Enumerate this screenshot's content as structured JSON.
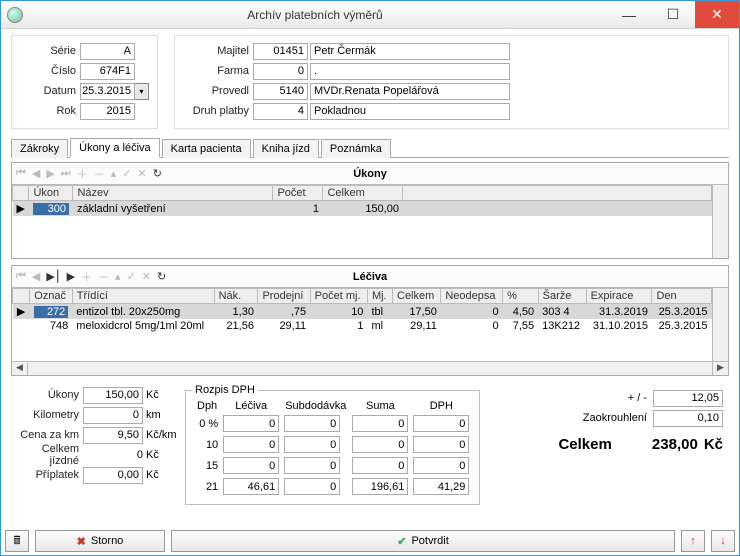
{
  "window": {
    "title": "Archív platebních výměrů"
  },
  "left": {
    "serie": {
      "label": "Série",
      "value": "A"
    },
    "cislo": {
      "label": "Číslo",
      "value": "674F1"
    },
    "datum": {
      "label": "Datum",
      "value": "25.3.2015"
    },
    "rok": {
      "label": "Rok",
      "value": "2015"
    }
  },
  "right": {
    "majitel": {
      "label": "Majitel",
      "code": "01451",
      "text": "Petr Čermák"
    },
    "farma": {
      "label": "Farma",
      "code": "0",
      "text": "."
    },
    "provedl": {
      "label": "Provedl",
      "code": "5140",
      "text": "MVDr.Renata Popelářová"
    },
    "platba": {
      "label": "Druh platby",
      "code": "4",
      "text": "Pokladnou"
    }
  },
  "tabs": [
    "Zákroky",
    "Úkony a léčiva",
    "Karta pacienta",
    "Kniha jízd",
    "Poznámka"
  ],
  "ukony": {
    "title": "Úkony",
    "cols": [
      "Úkon",
      "Název",
      "Počet",
      "Celkem"
    ],
    "rows": [
      {
        "ukon": "300",
        "nazev": "základní vyšetření",
        "pocet": "1",
        "celkem": "150,00"
      }
    ]
  },
  "leciva": {
    "title": "Léčiva",
    "cols": [
      "Označ",
      "Třídící",
      "Nák.",
      "Prodejní",
      "Počet mj.",
      "Mj.",
      "Celkem",
      "Neodepsa",
      "%",
      "Šarže",
      "Expirace",
      "Den"
    ],
    "rows": [
      {
        "oznac": "272",
        "trid": "entizol tbl. 20x250mg",
        "nak": "1,30",
        "prod": ",75",
        "pocet": "10",
        "mj": "tbl",
        "celkem": "17,50",
        "neod": "0",
        "pct": "4,50",
        "sarze": "303 4",
        "exp": "31.3.2019",
        "den": "25.3.2015"
      },
      {
        "oznac": "748",
        "trid": "meloxidcrol 5mg/1ml 20ml",
        "nak": "21,56",
        "prod": "29,11",
        "pocet": "1",
        "mj": "ml",
        "celkem": "29,11",
        "neod": "0",
        "pct": "7,55",
        "sarze": "13K212",
        "exp": "31.10.2015",
        "den": "25.3.2015"
      }
    ]
  },
  "sums": {
    "ukony": {
      "label": "Úkony",
      "value": "150,00",
      "unit": "Kč"
    },
    "km": {
      "label": "Kilometry",
      "value": "0",
      "unit": "km"
    },
    "cenakm": {
      "label": "Cena za km",
      "value": "9,50",
      "unit": "Kč/km"
    },
    "jizdne": {
      "label": "Celkem jízdné",
      "value": "0",
      "unit": "Kč"
    },
    "priplatek": {
      "label": "Příplatek",
      "value": "0,00",
      "unit": "Kč"
    }
  },
  "dph": {
    "legend": "Rozpis DPH",
    "cols": [
      "Dph",
      "Léčiva",
      "Subdodávka",
      "Suma",
      "DPH"
    ],
    "rows": [
      {
        "sazba": "0 %",
        "leciva": "0",
        "sub": "0",
        "suma": "0",
        "dph": "0"
      },
      {
        "sazba": "10",
        "leciva": "0",
        "sub": "0",
        "suma": "0",
        "dph": "0"
      },
      {
        "sazba": "15",
        "leciva": "0",
        "sub": "0",
        "suma": "0",
        "dph": "0"
      },
      {
        "sazba": "21",
        "leciva": "46,61",
        "sub": "0",
        "suma": "196,61",
        "dph": "41,29"
      }
    ]
  },
  "totals": {
    "plusminus": {
      "label": "+ / -",
      "value": "12,05"
    },
    "zaokr": {
      "label": "Zaokrouhlení",
      "value": "0,10"
    },
    "celkem": {
      "label": "Celkem",
      "value": "238,00",
      "unit": "Kč"
    }
  },
  "footer": {
    "storno": "Storno",
    "potvrdit": "Potvrdit"
  }
}
